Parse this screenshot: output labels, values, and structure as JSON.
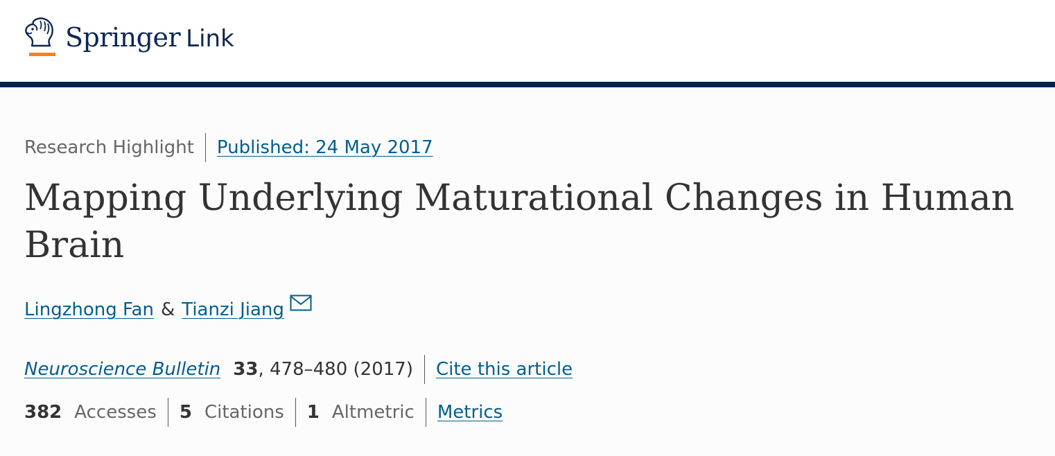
{
  "header": {
    "brand": "Springer",
    "product": "Link"
  },
  "article": {
    "type": "Research Highlight",
    "published": "Published: 24 May 2017",
    "title": "Mapping Underlying Maturational Changes in Human Brain",
    "authors": [
      {
        "name": "Lingzhong Fan"
      },
      {
        "name": "Tianzi Jiang"
      }
    ],
    "author_separator": "&",
    "journal": "Neuroscience Bulletin",
    "volume": "33",
    "pages_year": ", 478–480 (2017)",
    "cite_label": "Cite this article"
  },
  "metrics": {
    "accesses": {
      "value": "382",
      "label": "Accesses"
    },
    "citations": {
      "value": "5",
      "label": "Citations"
    },
    "altmetric": {
      "value": "1",
      "label": "Altmetric"
    },
    "link_label": "Metrics"
  },
  "icons": {
    "logo": "springer-horse-icon",
    "email": "envelope-icon"
  },
  "colors": {
    "navy": "#01224f",
    "link": "#025e8d",
    "accent_orange": "#f5811f",
    "text": "#333333",
    "muted": "#666666"
  }
}
